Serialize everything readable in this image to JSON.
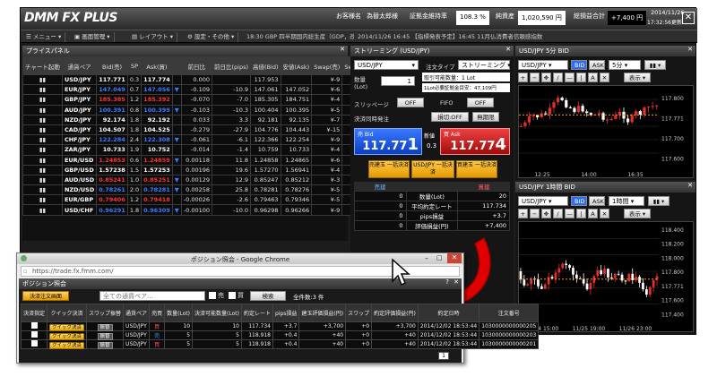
{
  "header": {
    "logo": "DMM FX PLUS",
    "customer_label": "お客様名",
    "customer_name": "為替太郎様",
    "margin_label": "証拠金維持率",
    "margin_value": "108.3 %",
    "equity_label": "純資産",
    "equity_value": "1,020,590 円",
    "pl_label": "総損益合計",
    "pl_value": "+7,400 円",
    "date": "2014/11/26",
    "time": "17:32:56更新"
  },
  "toolbar": {
    "menu": "メニュー",
    "screen": "画面管理",
    "layout": "レイアウト",
    "settings": "設定・その他",
    "ticker": "18:30 GBP 四半期国内総生産（GDP，改定",
    "news": "2014/11/26 16:45 【指標発表予定】16:45 11月仏消費者信頼感指数"
  },
  "rate_panel": {
    "title": "プライスパネル",
    "headers": [
      "チャート起動",
      "通貨ペア",
      "Bid(売)",
      "SP",
      "Ask(買)",
      "",
      "前日比",
      "前日比(pips)",
      "高値(Bid)",
      "安値(Ask)",
      "Swap(売)",
      "Swap(買)",
      "付与日数"
    ],
    "rows": [
      [
        "USD/JPY",
        "117.771",
        "0.3",
        "117.774",
        "",
        "0.000",
        "",
        "117.953",
        "",
        "¥-9",
        "3"
      ],
      [
        "EUR/JPY",
        "147.049",
        "0.7",
        "147.056",
        "▼",
        "-0.109",
        "-10.9",
        "147.061",
        "147.052",
        "¥-6",
        "3"
      ],
      [
        "GBP/JPY",
        "185.385",
        "1.2",
        "185.392",
        "",
        "-0.070",
        "-7.0",
        "185.305",
        "184.751",
        "¥-4",
        "3"
      ],
      [
        "AUD/JPY",
        "100.391",
        "0.8",
        "100.399",
        "▼",
        "-0.103",
        "-10.3",
        "100.404",
        "100.395",
        "¥-5",
        "3"
      ],
      [
        "NZD/JPY",
        "92.174",
        "1.8",
        "92.192",
        "",
        "0.033",
        "3.3",
        "92.181",
        "92.135",
        "¥-7",
        "3"
      ],
      [
        "CAD/JPY",
        "104.507",
        "1.8",
        "104.525",
        "",
        "-0.279",
        "-27.9",
        "104.776",
        "104.443",
        "¥-15",
        "3"
      ],
      [
        "CHF/JPY",
        "122.284",
        "2.4",
        "122.308",
        "▼",
        "-0.061",
        "-6.1",
        "122.366",
        "122.254",
        "¥-9",
        "3"
      ],
      [
        "ZAR/JPY",
        "10.733",
        "1.9",
        "10.752",
        "",
        "-0.014",
        "-1.4",
        "10.759",
        "10.733",
        "¥-4",
        "3"
      ],
      [
        "EUR/USD",
        "1.24853",
        "0.6",
        "1.24859",
        "▼",
        "0.00118",
        "11.8",
        "1.24858",
        "1.24865",
        "¥-6",
        "3"
      ],
      [
        "GBP/USD",
        "1.57238",
        "1.5",
        "1.57253",
        "",
        "0.00196",
        "19.6",
        "1.57270",
        "1.56941",
        "¥-4",
        "3"
      ],
      [
        "AUD/USD",
        "0.85241",
        "1.0",
        "0.85251",
        "▼",
        "0.00129",
        "12.9",
        "0.85247",
        "0.85212",
        "¥-3",
        "3"
      ],
      [
        "NZD/USD",
        "0.78261",
        "2.0",
        "0.78281",
        "▼",
        "0.00258",
        "25.8",
        "0.78281",
        "0.78276",
        "¥-5",
        "3"
      ],
      [
        "EUR/GBP",
        "0.79406",
        "1.2",
        "0.79418",
        "",
        "-0.00026",
        "-2.6",
        "0.79463",
        "0.79346",
        "¥-5",
        "3"
      ],
      [
        "USD/CHF",
        "0.96291",
        "1.8",
        "0.96309",
        "▼",
        "-0.00100",
        "-10.0",
        "0.96298",
        "0.96266",
        "¥-9",
        "3"
      ]
    ]
  },
  "stream": {
    "title": "ストリーミング (USD/JPY)",
    "pair": "USD/JPY",
    "order_type_label": "注文タイプ",
    "order_type": "ストリーミング",
    "qty_label": "数量 (Lot)",
    "qty": "1",
    "min_lot": "取引可能数量：1 Lot",
    "margin_need": "1Lot必要証拠金目安：47,109円",
    "slip_label": "スリッページ",
    "slip_value": "OFF",
    "fifo_label": "FIFO",
    "fifo_value": "OFF",
    "settle_label": "決済同時発注",
    "lossless_label": "損切",
    "lossless_value": "OFF",
    "limit_label": "無期限",
    "sell_label": "売 Bid",
    "sell_main": "117.77",
    "sell_big": "1",
    "spread": "0.3",
    "spread_label": "新値",
    "buy_label": "買 Ask",
    "buy_main": "117.77",
    "buy_big": "4",
    "btn_sell_all": "売建玉 一括決済",
    "btn_all": "USD/JPY 一括決済",
    "btn_buy_all": "買建玉 一括決済",
    "sell_head": "売建",
    "buy_head": "買建",
    "stats": [
      [
        "0",
        "数量(Lot)",
        "20"
      ],
      [
        "0",
        "平均約定レート",
        "117.734"
      ],
      [
        "0",
        "pips損益",
        "+3.7"
      ],
      [
        "0",
        "評価損益(円)",
        "+7,400"
      ]
    ]
  },
  "chart1": {
    "title": "USD/JPY 5分 BID",
    "pair": "USD/JPY",
    "bid": "BID",
    "ask": "ASK",
    "period": "5分",
    "display": "表示",
    "xticks": [
      "12:25",
      "14:00",
      "16:35"
    ],
    "ylabels": [
      "117.800",
      "117.771",
      "117.700",
      "117.600"
    ]
  },
  "chart2": {
    "title": "USD/JPY 1時間 BID",
    "pair": "USD/JPY",
    "bid": "BID",
    "ask": "ASK",
    "period": "1時間",
    "display": "表示",
    "xticks": [
      "11/24 15:00",
      "11/25 19:00",
      "11/26 23:00"
    ],
    "ylabels": [
      "118.400",
      "118.200",
      "118.000",
      "117.800",
      "117.771",
      "117.600",
      "117.400"
    ]
  },
  "popup": {
    "window_title": "ポジション照会 - Google Chrome",
    "url": "https://trade.fx.fmm.com/",
    "panel_title": "ポジション照会",
    "settle_btn": "決済注文画面",
    "search_placeholder": "全ての通貨ペア...",
    "sell_check": "売",
    "buy_check": "買",
    "search_btn": "検索",
    "count": "全件数:3 件",
    "headers": [
      "決済指定",
      "クイック決済",
      "スワップ振替",
      "通貨ペア",
      "売買",
      "数量(Lot)",
      "決済可能数量(Lot)",
      "約定レート",
      "pips損益",
      "建玉評価損益(円)",
      "スワップ",
      "約定評価損益(円)",
      "約定日時",
      "注文番号"
    ],
    "rows": [
      [
        "クイック決済",
        "振替",
        "USD/JPY",
        "買",
        "10",
        "10",
        "117.734",
        "+3.7",
        "+3,700",
        "+0",
        "+3,700",
        "2014/12/02 18:53:44",
        "1030000000000205"
      ],
      [
        "クイック決済",
        "振替",
        "USD/JPY",
        "売",
        "5",
        "5",
        "118.918",
        "+0.4",
        "+40",
        "+0",
        "+40",
        "2014/12/02 18:53:44",
        "1030000000000203"
      ],
      [
        "クイック決済",
        "振替",
        "USD/JPY",
        "買",
        "5",
        "5",
        "118.918",
        "+0.4",
        "+40",
        "+0",
        "+40",
        "2014/12/02 18:53:44",
        "1030000000000201"
      ]
    ],
    "page": "1"
  },
  "colors": {
    "up": "#e03030",
    "down": "#ffffff",
    "accent": "#ff9900"
  }
}
